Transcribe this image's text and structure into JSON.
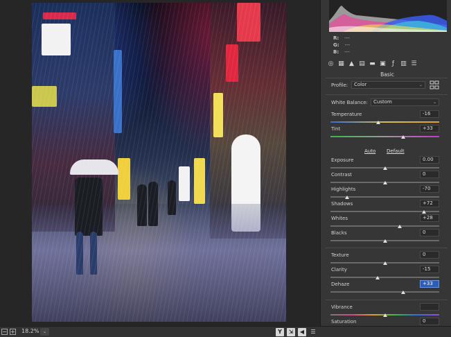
{
  "bottom": {
    "minus": "−",
    "plus": "+",
    "zoom": "18.2%",
    "zoom_caret": "⌄",
    "view_buttons": [
      "Y",
      "⇲",
      "◀",
      "☰"
    ]
  },
  "histogram": {
    "r_label": "R:",
    "r_value": "---",
    "g_label": "G:",
    "g_value": "---",
    "b_label": "B:",
    "b_value": "---"
  },
  "panel": {
    "section_title": "Basic",
    "profile_label": "Profile:",
    "profile_value": "Color",
    "white_balance_label": "White Balance:",
    "white_balance_value": "Custom",
    "auto_label": "Auto",
    "default_label": "Default",
    "tab_icons": [
      "camera-raw-basic-icon",
      "tone-curve-icon",
      "detail-icon",
      "hsl-icon",
      "split-tone-icon",
      "lens-icon",
      "effects-icon",
      "calibration-icon",
      "presets-icon"
    ],
    "sliders": [
      {
        "label": "Temperature",
        "value": "-16",
        "position": 0.44,
        "track": "temperature"
      },
      {
        "label": "Tint",
        "value": "+33",
        "position": 0.67,
        "track": "tint"
      },
      {
        "label": "Exposure",
        "value": "0.00",
        "position": 0.5,
        "track": "plain"
      },
      {
        "label": "Contrast",
        "value": "0",
        "position": 0.5,
        "track": "plain"
      },
      {
        "label": "Highlights",
        "value": "-70",
        "position": 0.15,
        "track": "plain"
      },
      {
        "label": "Shadows",
        "value": "+72",
        "position": 0.86,
        "track": "plain"
      },
      {
        "label": "Whites",
        "value": "+28",
        "position": 0.64,
        "track": "plain"
      },
      {
        "label": "Blacks",
        "value": "0",
        "position": 0.5,
        "track": "plain"
      },
      {
        "label": "Texture",
        "value": "0",
        "position": 0.5,
        "track": "plain"
      },
      {
        "label": "Clarity",
        "value": "-15",
        "position": 0.43,
        "track": "plain"
      },
      {
        "label": "Dehaze",
        "value": "+33",
        "position": 0.67,
        "track": "plain",
        "active": true
      },
      {
        "label": "Vibrance",
        "value": "",
        "position": 0.5,
        "track": "vibrance"
      },
      {
        "label": "Saturation",
        "value": "0",
        "position": 0.5,
        "track": "saturation"
      }
    ]
  },
  "colors": {
    "accent": "#2b5cb8",
    "panel_bg": "#363636"
  }
}
